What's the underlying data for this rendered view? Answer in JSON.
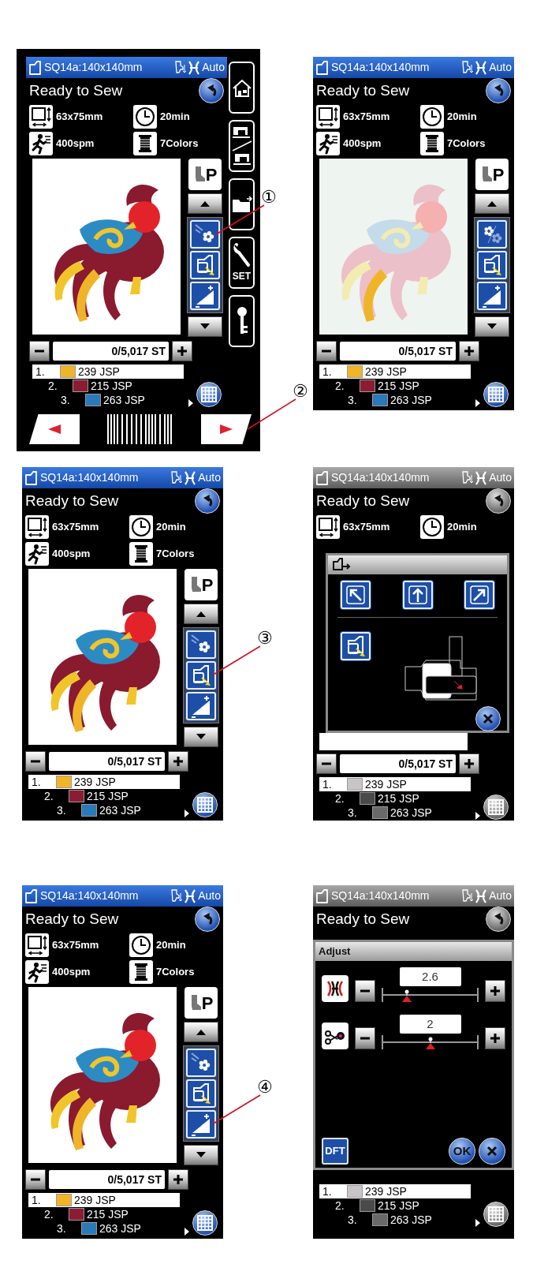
{
  "screens": [
    {
      "kind": "main",
      "greyed_out": false,
      "title": "SQ14a:140x140mm",
      "mode": "Auto",
      "status": "Ready to Sew",
      "info": [
        {
          "kind": "size",
          "text": "63x75mm"
        },
        {
          "kind": "time",
          "text": "20min"
        },
        {
          "kind": "speed",
          "text": "400spm"
        },
        {
          "kind": "colors",
          "text": "7Colors"
        }
      ],
      "design": {
        "faded": false
      },
      "foot_label": "P",
      "stitch_count": "0/5,017 ST",
      "sidebar": {
        "set_label": "SET"
      },
      "thread_list": [
        {
          "number": "1.",
          "code": "239 JSP",
          "color": "#f0b428",
          "selected": true
        },
        {
          "number": "2.",
          "code": "215 JSP",
          "color": "#8c1c34",
          "selected": false
        },
        {
          "number": "3.",
          "code": "263 JSP",
          "color": "#2a7ab8",
          "selected": false
        }
      ],
      "trace_callout": "①",
      "next_callout": "②"
    },
    {
      "kind": "main",
      "greyed_out": false,
      "title": "SQ14a:140x140mm",
      "mode": "Auto",
      "status": "Ready to Sew",
      "info": [
        {
          "kind": "size",
          "text": "63x75mm"
        },
        {
          "kind": "time",
          "text": "20min"
        },
        {
          "kind": "speed",
          "text": "400spm"
        },
        {
          "kind": "colors",
          "text": "7Colors"
        }
      ],
      "design": {
        "faded": true
      },
      "foot_label": "P",
      "stitch_count": "0/5,017 ST",
      "thread_list": [
        {
          "number": "1.",
          "code": "239 JSP",
          "color": "#f0b428",
          "selected": true
        },
        {
          "number": "2.",
          "code": "215 JSP",
          "color": "#8c1c34",
          "selected": false
        },
        {
          "number": "3.",
          "code": "263 JSP",
          "color": "#2a7ab8",
          "selected": false
        }
      ]
    },
    {
      "kind": "main",
      "greyed_out": false,
      "title": "SQ14a:140x140mm",
      "mode": "Auto",
      "status": "Ready to Sew",
      "info": [
        {
          "kind": "size",
          "text": "63x75mm"
        },
        {
          "kind": "time",
          "text": "20min"
        },
        {
          "kind": "speed",
          "text": "400spm"
        },
        {
          "kind": "colors",
          "text": "7Colors"
        }
      ],
      "design": {
        "faded": false
      },
      "foot_label": "P",
      "stitch_count": "0/5,017 ST",
      "thread_list": [
        {
          "number": "1.",
          "code": "239 JSP",
          "color": "#f0b428",
          "selected": true
        },
        {
          "number": "2.",
          "code": "215 JSP",
          "color": "#8c1c34",
          "selected": false
        },
        {
          "number": "3.",
          "code": "263 JSP",
          "color": "#2a7ab8",
          "selected": false
        }
      ],
      "move_callout": "③"
    },
    {
      "kind": "move_dialog",
      "greyed_out": true,
      "title": "SQ14a:140x140mm",
      "mode": "Auto",
      "status": "Ready to Sew",
      "info": [
        {
          "kind": "size",
          "text": "63x75mm"
        },
        {
          "kind": "time",
          "text": "20min"
        }
      ],
      "stitch_count": "0/5,017 ST",
      "thread_list": [
        {
          "number": "1.",
          "code": "239 JSP",
          "color": "#c8c4c8",
          "selected": true
        },
        {
          "number": "2.",
          "code": "215 JSP",
          "color": "#4a4a4a",
          "selected": false
        },
        {
          "number": "3.",
          "code": "263 JSP",
          "color": "#6a6a6a",
          "selected": false
        }
      ]
    },
    {
      "kind": "main",
      "greyed_out": false,
      "title": "SQ14a:140x140mm",
      "mode": "Auto",
      "status": "Ready to Sew",
      "info": [
        {
          "kind": "size",
          "text": "63x75mm"
        },
        {
          "kind": "time",
          "text": "20min"
        },
        {
          "kind": "speed",
          "text": "400spm"
        },
        {
          "kind": "colors",
          "text": "7Colors"
        }
      ],
      "design": {
        "faded": false
      },
      "foot_label": "P",
      "stitch_count": "0/5,017 ST",
      "thread_list": [
        {
          "number": "1.",
          "code": "239 JSP",
          "color": "#f0b428",
          "selected": true
        },
        {
          "number": "2.",
          "code": "215 JSP",
          "color": "#8c1c34",
          "selected": false
        },
        {
          "number": "3.",
          "code": "263 JSP",
          "color": "#2a7ab8",
          "selected": false
        }
      ],
      "adjust_callout": "④"
    },
    {
      "kind": "adjust_dialog",
      "greyed_out": true,
      "title": "SQ14a:140x140mm",
      "mode": "Auto",
      "status": "Ready to Sew",
      "dialog": {
        "title": "Adjust",
        "rows": [
          {
            "kind": "tension",
            "value": "2.6",
            "level": 0.25
          },
          {
            "kind": "trim",
            "value": "2",
            "level": 0.5
          }
        ],
        "default_label": "DFT",
        "ok_label": "OK"
      },
      "thread_list": [
        {
          "number": "1.",
          "code": "239 JSP",
          "color": "#c8c4c8",
          "selected": true
        },
        {
          "number": "2.",
          "code": "215 JSP",
          "color": "#4a4a4a",
          "selected": false
        },
        {
          "number": "3.",
          "code": "263 JSP",
          "color": "#6a6a6a",
          "selected": false
        }
      ]
    }
  ]
}
